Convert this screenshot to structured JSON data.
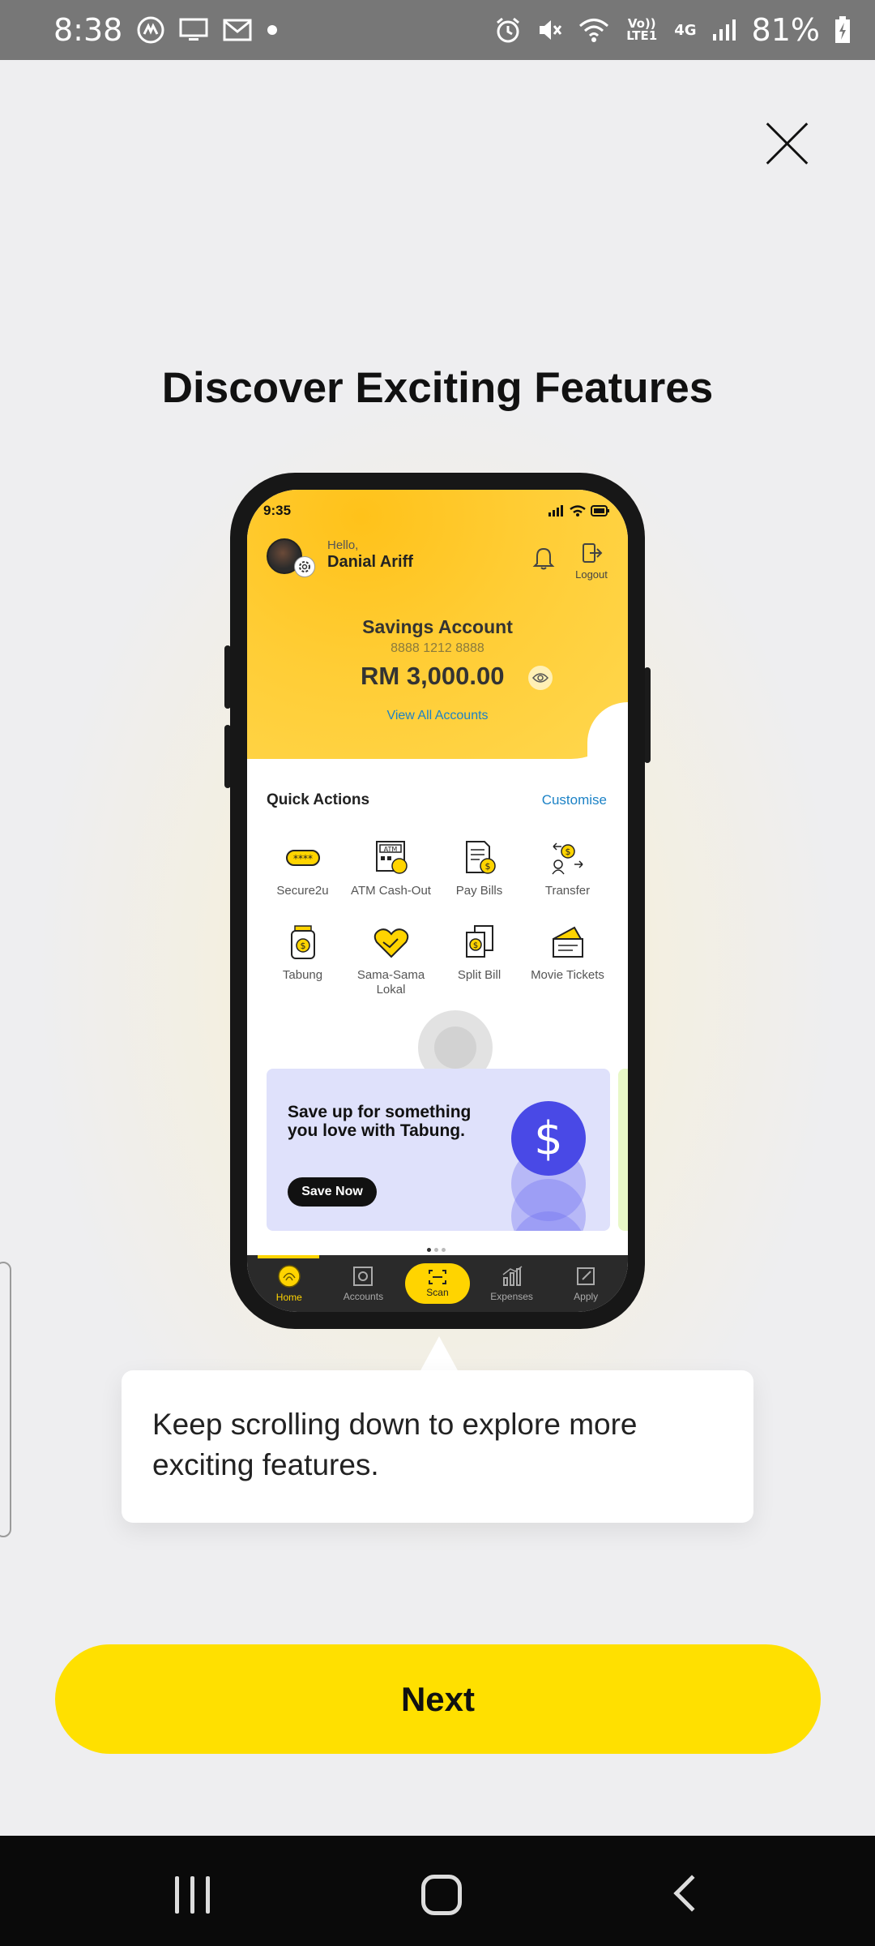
{
  "status_bar": {
    "time": "8:38",
    "battery": "81%",
    "network_volte": "Vo)) LTE1",
    "network_type": "4G"
  },
  "onboarding": {
    "title": "Discover Exciting Features",
    "tooltip": "Keep scrolling down to explore more exciting features.",
    "next_label": "Next"
  },
  "phone": {
    "time": "9:35",
    "greeting": "Hello,",
    "user_name": "Danial Ariff",
    "logout_label": "Logout",
    "account": {
      "name": "Savings Account",
      "number": "8888 1212 8888",
      "balance": "RM 3,000.00",
      "view_all": "View All Accounts"
    },
    "quick_actions": {
      "title": "Quick Actions",
      "customise": "Customise",
      "items": [
        {
          "label": "Secure2u",
          "icon": "card-pin-icon"
        },
        {
          "label": "ATM Cash-Out",
          "icon": "atm-icon"
        },
        {
          "label": "Pay Bills",
          "icon": "bill-icon"
        },
        {
          "label": "Transfer",
          "icon": "transfer-icon"
        },
        {
          "label": "Tabung",
          "icon": "jar-icon"
        },
        {
          "label": "Sama-Sama Lokal",
          "icon": "handshake-icon"
        },
        {
          "label": "Split Bill",
          "icon": "split-bill-icon"
        },
        {
          "label": "Movie Tickets",
          "icon": "ticket-icon"
        }
      ]
    },
    "promo": {
      "text": "Save up for something you love with Tabung.",
      "button": "Save Now",
      "coin_symbol": "$"
    },
    "bottom_nav": [
      {
        "label": "Home",
        "active": true
      },
      {
        "label": "Accounts",
        "active": false
      },
      {
        "label": "Scan",
        "active": false
      },
      {
        "label": "Expenses",
        "active": false
      },
      {
        "label": "Apply",
        "active": false
      }
    ]
  },
  "colors": {
    "accent_yellow": "#ffe000",
    "link_blue": "#1c82c6",
    "promo_coin": "#4949e6"
  }
}
